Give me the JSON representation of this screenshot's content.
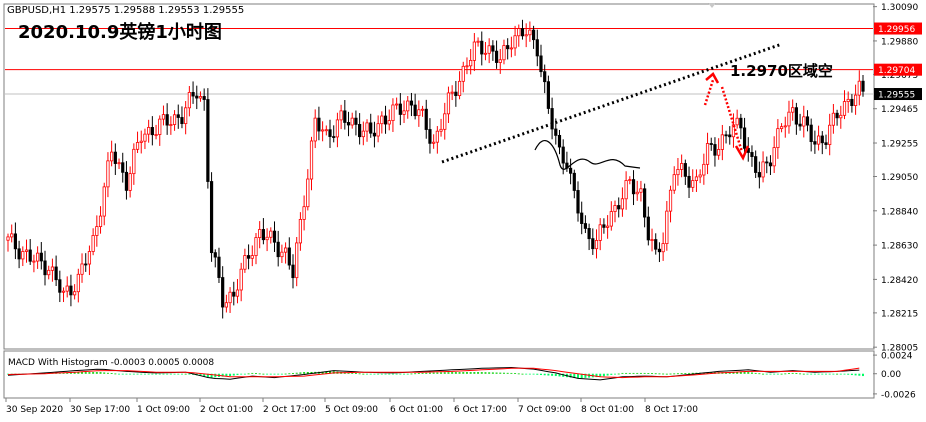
{
  "window": {
    "symbol_header": "GBPUSD,H1  1.29575 1.29588 1.29553 1.29555",
    "big_title": "2020.10.9英镑1小时图"
  },
  "annotation": {
    "text": "1.2970区域空"
  },
  "colors": {
    "bull": "#ff0000",
    "bear": "#000000",
    "hist_up": "#00d000",
    "hist_down": "#00ff66",
    "macd_line": "#000000",
    "signal_line": "#ff0000",
    "level_line": "#ff0000",
    "current_line": "#c0c0c0",
    "trend_dotted": "#000000",
    "arrow": "#ff0000"
  },
  "icons": [
    "triangle-down-icon"
  ],
  "chart_data": [
    {
      "type": "candlestick",
      "title": "GBPUSD,H1",
      "ylim": [
        1.28,
        1.301
      ],
      "y_ticks": [
        "1.30090",
        "1.29880",
        "1.29675",
        "1.29465",
        "1.29255",
        "1.29050",
        "1.28840",
        "1.28630",
        "1.28420",
        "1.28215",
        "1.28005"
      ],
      "price_labels": [
        {
          "text": "1.29956",
          "value": 1.29956,
          "kind": "level"
        },
        {
          "text": "1.29704",
          "value": 1.29704,
          "kind": "level"
        },
        {
          "text": "1.29555",
          "value": 1.29555,
          "kind": "current"
        }
      ],
      "x_labels": [
        "30 Sep 2020",
        "30 Sep 17:00",
        "1 Oct 09:00",
        "2 Oct 01:00",
        "2 Oct 17:00",
        "5 Oct 09:00",
        "6 Oct 01:00",
        "6 Oct 17:00",
        "7 Oct 09:00",
        "8 Oct 01:00",
        "8 Oct 17:00"
      ],
      "close_path": [
        [
          0,
          1.2866
        ],
        [
          6,
          1.2855
        ],
        [
          11,
          1.285
        ],
        [
          15,
          1.2832
        ],
        [
          19,
          1.2842
        ],
        [
          23,
          1.2865
        ],
        [
          28,
          1.292
        ],
        [
          32,
          1.2902
        ],
        [
          36,
          1.293
        ],
        [
          40,
          1.2935
        ],
        [
          44,
          1.294
        ],
        [
          47,
          1.2942
        ],
        [
          51,
          1.2958
        ],
        [
          53,
          1.295
        ],
        [
          55,
          1.286
        ],
        [
          58,
          1.283
        ],
        [
          61,
          1.2832
        ],
        [
          65,
          1.2858
        ],
        [
          68,
          1.287
        ],
        [
          72,
          1.2865
        ],
        [
          75,
          1.2857
        ],
        [
          77,
          1.2845
        ],
        [
          80,
          1.2892
        ],
        [
          83,
          1.2938
        ],
        [
          86,
          1.293
        ],
        [
          90,
          1.294
        ],
        [
          94,
          1.2937
        ],
        [
          98,
          1.293
        ],
        [
          101,
          1.294
        ],
        [
          105,
          1.2945
        ],
        [
          109,
          1.295
        ],
        [
          112,
          1.294
        ],
        [
          115,
          1.2925
        ],
        [
          119,
          1.295
        ],
        [
          122,
          1.2965
        ],
        [
          126,
          1.2983
        ],
        [
          129,
          1.2985
        ],
        [
          133,
          1.2975
        ],
        [
          136,
          1.299
        ],
        [
          140,
          1.2993
        ],
        [
          143,
          1.2985
        ],
        [
          146,
          1.2945
        ],
        [
          149,
          1.292
        ],
        [
          151,
          1.2915
        ],
        [
          153,
          1.2892
        ],
        [
          156,
          1.287
        ],
        [
          159,
          1.2865
        ],
        [
          162,
          1.2878
        ],
        [
          165,
          1.289
        ],
        [
          168,
          1.29
        ],
        [
          171,
          1.2895
        ],
        [
          173,
          1.287
        ],
        [
          175,
          1.2855
        ],
        [
          177,
          1.2868
        ],
        [
          180,
          1.291
        ],
        [
          183,
          1.2905
        ],
        [
          186,
          1.2902
        ],
        [
          189,
          1.292
        ],
        [
          192,
          1.2925
        ],
        [
          195,
          1.2932
        ],
        [
          198,
          1.2938
        ],
        [
          200,
          1.2918
        ],
        [
          203,
          1.2905
        ],
        [
          206,
          1.2918
        ],
        [
          209,
          1.2935
        ],
        [
          212,
          1.2945
        ],
        [
          215,
          1.2937
        ],
        [
          218,
          1.2925
        ],
        [
          221,
          1.293
        ],
        [
          224,
          1.2942
        ],
        [
          227,
          1.2952
        ],
        [
          230,
          1.2957
        ],
        [
          231,
          1.29555
        ]
      ],
      "total_bars": 232
    },
    {
      "type": "bar",
      "title": "MACD With Histogram -0.0003 0.0005 0.0008",
      "ylim": [
        -0.003,
        0.0028
      ],
      "y_ticks": [
        "0.0024",
        "0.00",
        "-0.0026"
      ],
      "series": [
        {
          "name": "MACD",
          "points": [
            [
              0,
              -0.0002
            ],
            [
              10,
              0.0001
            ],
            [
              18,
              0.0004
            ],
            [
              25,
              0.0006
            ],
            [
              32,
              0.0003
            ],
            [
              40,
              0.0001
            ],
            [
              48,
              0.0002
            ],
            [
              55,
              -0.0006
            ],
            [
              60,
              -0.0007
            ],
            [
              66,
              -0.0003
            ],
            [
              72,
              -0.0005
            ],
            [
              80,
              -0.0001
            ],
            [
              88,
              0.0004
            ],
            [
              96,
              0.0002
            ],
            [
              104,
              0.0001
            ],
            [
              112,
              0.0003
            ],
            [
              120,
              0.0005
            ],
            [
              128,
              0.0007
            ],
            [
              136,
              0.0008
            ],
            [
              142,
              0.0006
            ],
            [
              148,
              0.0001
            ],
            [
              154,
              -0.0006
            ],
            [
              160,
              -0.0008
            ],
            [
              166,
              -0.0004
            ],
            [
              172,
              -0.0003
            ],
            [
              178,
              -0.0004
            ],
            [
              184,
              -0.0001
            ],
            [
              192,
              0.0003
            ],
            [
              200,
              0.0005
            ],
            [
              206,
              0.0002
            ],
            [
              212,
              0.0004
            ],
            [
              218,
              0.0002
            ],
            [
              224,
              0.0003
            ],
            [
              231,
              0.0005
            ]
          ]
        },
        {
          "name": "Signal",
          "points": [
            [
              0,
              -0.0001
            ],
            [
              10,
              0.0
            ],
            [
              18,
              0.0002
            ],
            [
              25,
              0.0004
            ],
            [
              32,
              0.0004
            ],
            [
              40,
              0.0002
            ],
            [
              48,
              0.0002
            ],
            [
              55,
              -0.0001
            ],
            [
              60,
              -0.0004
            ],
            [
              66,
              -0.0004
            ],
            [
              72,
              -0.0004
            ],
            [
              80,
              -0.0003
            ],
            [
              88,
              0.0001
            ],
            [
              96,
              0.0002
            ],
            [
              104,
              0.0002
            ],
            [
              112,
              0.0002
            ],
            [
              120,
              0.0003
            ],
            [
              128,
              0.0005
            ],
            [
              136,
              0.0007
            ],
            [
              142,
              0.0007
            ],
            [
              148,
              0.0004
            ],
            [
              154,
              0.0
            ],
            [
              160,
              -0.0004
            ],
            [
              166,
              -0.0005
            ],
            [
              172,
              -0.0004
            ],
            [
              178,
              -0.0004
            ],
            [
              184,
              -0.0002
            ],
            [
              192,
              0.0001
            ],
            [
              200,
              0.0003
            ],
            [
              206,
              0.0003
            ],
            [
              212,
              0.0003
            ],
            [
              218,
              0.0003
            ],
            [
              224,
              0.0003
            ],
            [
              231,
              0.0008
            ]
          ]
        }
      ]
    }
  ]
}
